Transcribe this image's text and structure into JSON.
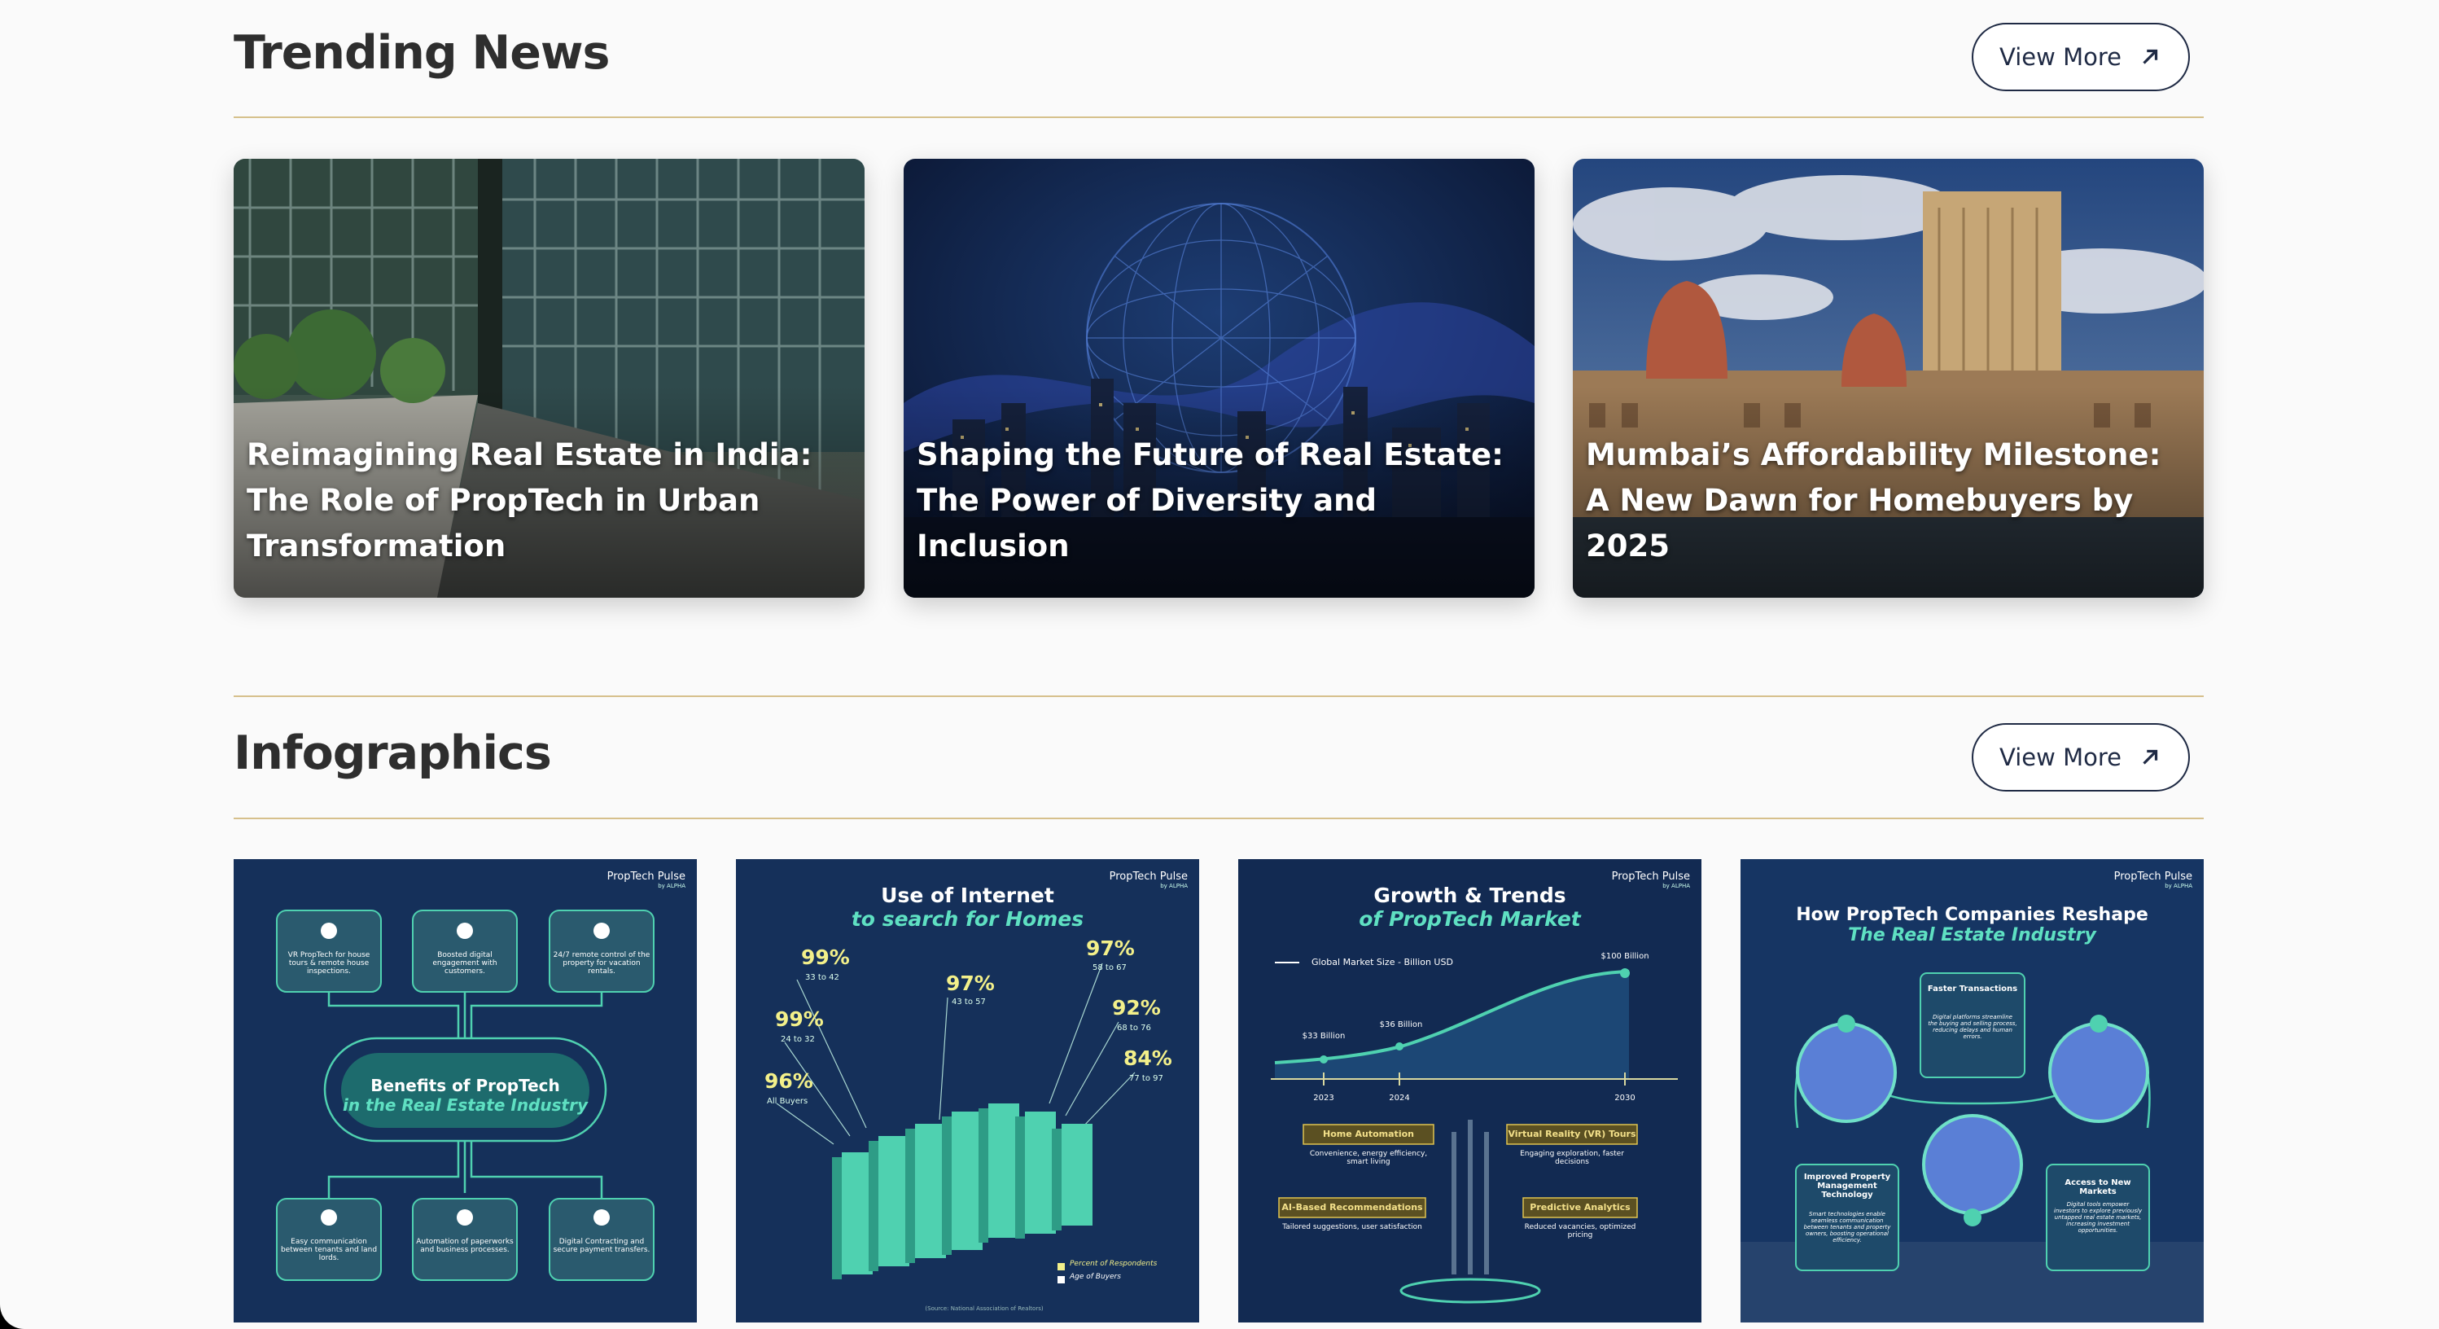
{
  "trending": {
    "title": "Trending News",
    "view_more": "View More",
    "cards": [
      {
        "title": "Reimagining Real Estate in India: The Role of PropTech in Urban Transformation"
      },
      {
        "title": "Shaping the Future of Real Estate: The Power of Diversity and Inclusion"
      },
      {
        "title": "Mumbai’s Affordability Milestone: A New Dawn for Homebuyers by 2025"
      }
    ]
  },
  "infographics": {
    "title": "Infographics",
    "view_more": "View More",
    "brand": "PropTech Pulse",
    "brand_sub": "by ALPHA",
    "benefits": {
      "title": "Benefits of PropTech",
      "subtitle": "in the Real Estate Industry",
      "items": [
        "VR PropTech for house tours & remote house inspections.",
        "Boosted digital engagement with customers.",
        "24/7 remote control of the property for vacation rentals.",
        "Easy communication between tenants and land lords.",
        "Automation of paperworks and business processes.",
        "Digital Contracting and secure payment transfers."
      ]
    },
    "internet": {
      "title": "Use of Internet",
      "subtitle": "to search for Homes",
      "stats": [
        {
          "pct": "99%",
          "range": "33 to 42"
        },
        {
          "pct": "99%",
          "range": "24 to 32"
        },
        {
          "pct": "96%",
          "range": "All Buyers"
        },
        {
          "pct": "97%",
          "range": "43 to 57"
        },
        {
          "pct": "97%",
          "range": "58 to 67"
        },
        {
          "pct": "92%",
          "range": "68 to 76"
        },
        {
          "pct": "84%",
          "range": "77 to 97"
        }
      ],
      "legend": [
        "Percent of Respondents",
        "Age of Buyers"
      ],
      "source": "(Source: National Association of Realtors)"
    },
    "growth": {
      "title": "Growth & Trends",
      "subtitle": "of PropTech Market",
      "legend": "Global Market Size - Billion USD",
      "points": [
        {
          "year": "2023",
          "label": "$33 Billion"
        },
        {
          "year": "2024",
          "label": "$36 Billion"
        },
        {
          "year": "2030",
          "label": "$100 Billion"
        }
      ],
      "trends": [
        {
          "name": "Home Automation",
          "desc": "Convenience, energy efficiency, smart living"
        },
        {
          "name": "Virtual Reality (VR) Tours",
          "desc": "Engaging exploration, faster decisions"
        },
        {
          "name": "AI-Based Recommendations",
          "desc": "Tailored suggestions, user satisfaction"
        },
        {
          "name": "Predictive Analytics",
          "desc": "Reduced vacancies, optimized pricing"
        }
      ]
    },
    "reshape": {
      "title": "How PropTech Companies Reshape",
      "subtitle": "The Real Estate Industry",
      "boxes": [
        {
          "name": "Faster Transactions",
          "desc": "Digital platforms streamline the buying and selling process, reducing delays and human errors."
        },
        {
          "name": "Improved Property Management Technology",
          "desc": "Smart technologies enable seamless communication between tenants and property owners, boosting operational efficiency."
        },
        {
          "name": "Access to New Markets",
          "desc": "Digital tools empower investors to explore previously untapped real estate markets, increasing investment opportunities."
        }
      ]
    }
  }
}
